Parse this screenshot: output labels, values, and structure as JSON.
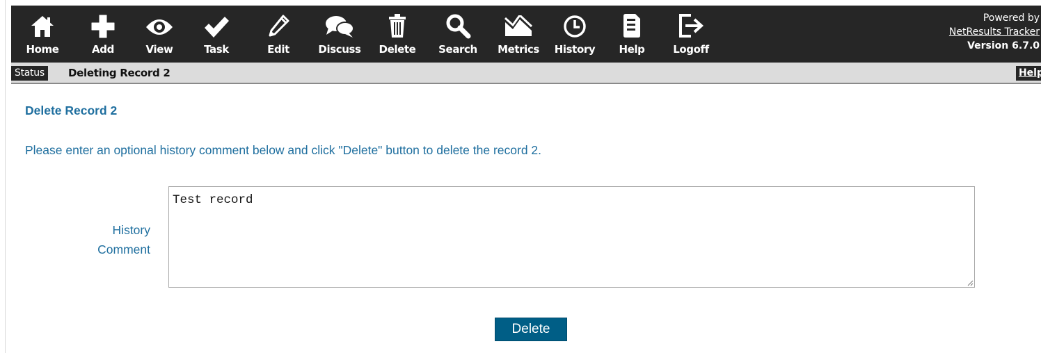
{
  "toolbar": {
    "items": [
      {
        "label": "Home",
        "icon": "home-icon"
      },
      {
        "label": "Add",
        "icon": "plus-icon"
      },
      {
        "label": "View",
        "icon": "eye-icon"
      },
      {
        "label": "Task",
        "icon": "checkmark-icon"
      },
      {
        "label": "Edit",
        "icon": "pencil-icon"
      },
      {
        "label": "Discuss",
        "icon": "speech-bubbles-icon"
      },
      {
        "label": "Delete",
        "icon": "trash-icon"
      },
      {
        "label": "Search",
        "icon": "magnifier-icon"
      },
      {
        "label": "Metrics",
        "icon": "chart-icon"
      },
      {
        "label": "History",
        "icon": "clock-icon"
      },
      {
        "label": "Help",
        "icon": "document-icon"
      },
      {
        "label": "Logoff",
        "icon": "logoff-icon"
      }
    ],
    "powered_by": "Powered by",
    "product_link": "NetResults Tracker",
    "version": "Version 6.7.0",
    "background_color": "#262626"
  },
  "status_bar": {
    "tag": "Status",
    "text": "Deleting Record 2",
    "help": "Help"
  },
  "main": {
    "title": "Delete Record 2",
    "instructions": "Please enter an optional history comment below and click \"Delete\" button to delete the record 2.",
    "comment_label_line1": "History",
    "comment_label_line2": "Comment",
    "comment_value": "Test record",
    "delete_button": "Delete",
    "accent_color": "#1f6f9f",
    "button_color": "#005e86"
  }
}
